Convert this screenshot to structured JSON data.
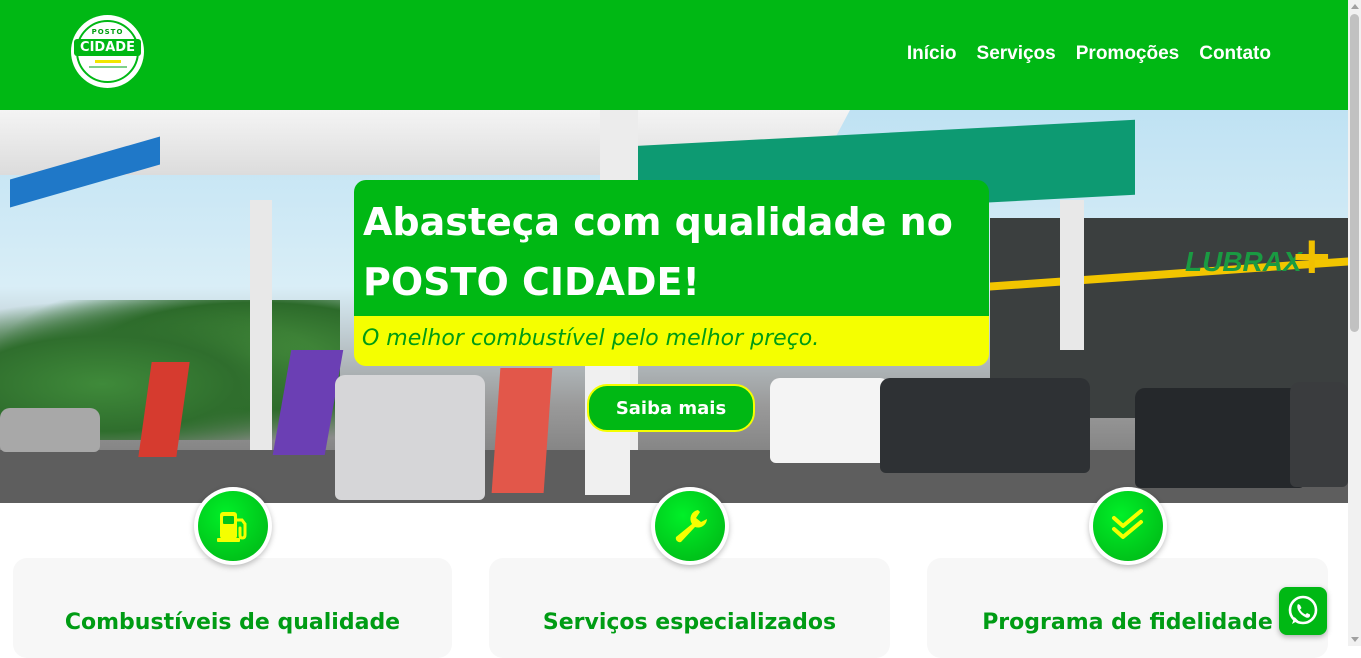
{
  "header": {
    "logo": {
      "top_text": "POSTO",
      "main_text": "CIDADE"
    },
    "nav": [
      {
        "label": "Início"
      },
      {
        "label": "Serviços"
      },
      {
        "label": "Promoções"
      },
      {
        "label": "Contato"
      }
    ]
  },
  "hero": {
    "title": "Abasteça com qualidade no POSTO CIDADE!",
    "subtitle": "O melhor combustível pelo melhor preço.",
    "button_label": "Saiba mais"
  },
  "cards": [
    {
      "icon": "fuel-pump-icon",
      "title": "Combustíveis de qualidade"
    },
    {
      "icon": "wrench-icon",
      "title": "Serviços especializados"
    },
    {
      "icon": "double-check-icon",
      "title": "Programa de fidelidade"
    }
  ],
  "colors": {
    "brand_green": "#00b814",
    "accent_yellow": "#f5ff00",
    "text_green": "#009c14"
  },
  "floating": {
    "whatsapp_icon": "whatsapp-icon"
  }
}
